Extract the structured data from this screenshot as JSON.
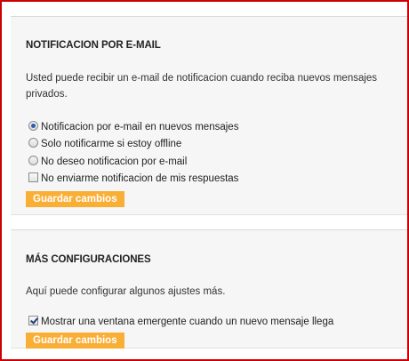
{
  "email_section": {
    "title": "NOTIFICACION POR E-MAIL",
    "description_line1": "Usted puede recibir un e-mail de notificacion cuando reciba nuevos mensajes",
    "description_line2": "privados.",
    "options": [
      {
        "label": "Notificacion por e-mail en nuevos mensajes",
        "type": "radio",
        "checked": true
      },
      {
        "label": "Solo notificarme si estoy offline",
        "type": "radio",
        "checked": false
      },
      {
        "label": "No deseo notificacion por e-mail",
        "type": "radio",
        "checked": false
      },
      {
        "label": "No enviarme notificacion de mis respuestas",
        "type": "checkbox",
        "checked": false
      }
    ],
    "save_label": "Guardar cambios"
  },
  "more_section": {
    "title": "MÁS CONFIGURACIONES",
    "description": "Aquí puede configurar algunos ajustes más.",
    "popup_option": {
      "label": "Mostrar una ventana emergente cuando un nuevo mensaje llega",
      "checked": true
    },
    "save_label": "Guardar cambios"
  },
  "colors": {
    "frame_border": "#cc0000",
    "panel_bg": "#f6f6f6",
    "button_bg": "#f9ae36",
    "button_text": "#ffffff"
  }
}
